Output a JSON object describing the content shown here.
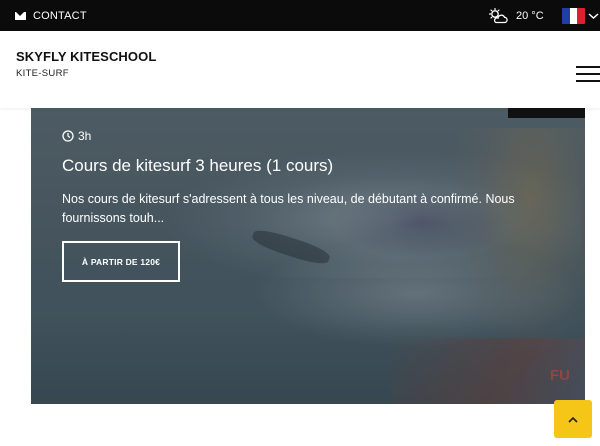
{
  "topbar": {
    "contact_label": "CONTACT",
    "temperature": "20 °C",
    "language_flag_colors": [
      "#1f3fa3",
      "#ffffff",
      "#e02030"
    ]
  },
  "header": {
    "site_title": "SKYFLY KITESCHOOL",
    "site_subtitle": "KITE-SURF"
  },
  "card": {
    "duration": "3h",
    "title": "Cours de kitesurf 3 heures (1 cours)",
    "description": "Nos cours de kitesurf s'adressent à tous les niveau, de débutant à confirmé. Nous fournissons touh...",
    "cta_label": "À PARTIR DE 120€",
    "image_text": "FU"
  },
  "colors": {
    "topbar_bg": "#0b0b0b",
    "accent_yellow": "#f5c518"
  },
  "icons": {
    "contact": "mail-icon",
    "weather": "partly-cloudy-icon",
    "language": "france-flag-icon",
    "dropdown": "chevron-down-icon",
    "menu": "hamburger-menu-icon",
    "duration": "clock-icon",
    "scroll": "arrow-up-icon"
  }
}
